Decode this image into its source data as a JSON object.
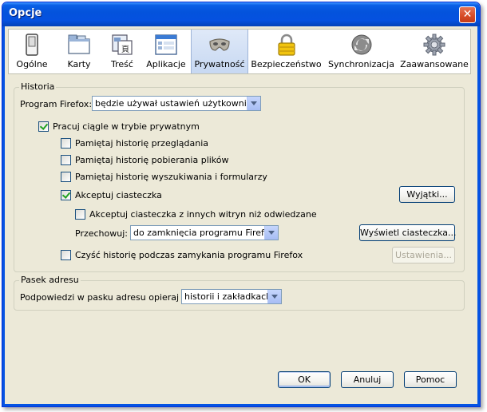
{
  "window": {
    "title": "Opcje",
    "close_glyph": "✕"
  },
  "toolbar": {
    "tabs": [
      {
        "label": "Ogólne",
        "icon": "switch-icon"
      },
      {
        "label": "Karty",
        "icon": "tabs-window-icon"
      },
      {
        "label": "Treść",
        "icon": "content-page-icon"
      },
      {
        "label": "Aplikacje",
        "icon": "applications-window-icon"
      },
      {
        "label": "Prywatność",
        "icon": "privacy-mask-icon"
      },
      {
        "label": "Bezpieczeństwo",
        "icon": "padlock-icon"
      },
      {
        "label": "Synchronizacja",
        "icon": "sync-icon"
      },
      {
        "label": "Zaawansowane",
        "icon": "gear-icon"
      }
    ],
    "selected": "Prywatność"
  },
  "history": {
    "group_title": "Historia",
    "program_label": "Program Firefox:",
    "program_value": "będzie używał ustawień użytkownika",
    "private_mode": {
      "label": "Pracuj ciągle w trybie prywatnym",
      "checked": true
    },
    "browse_history": {
      "label": "Pamiętaj historię przeglądania",
      "checked": false
    },
    "download_history": {
      "label": "Pamiętaj historię pobierania plików",
      "checked": false
    },
    "search_history": {
      "label": "Pamiętaj historię wyszukiwania i formularzy",
      "checked": false
    },
    "accept_cookies": {
      "label": "Akceptuj ciasteczka",
      "checked": true
    },
    "exceptions_button": "Wyjątki...",
    "third_party": {
      "label": "Akceptuj ciasteczka z innych witryn niż odwiedzane",
      "checked": false
    },
    "keep_label": "Przechowuj:",
    "keep_value": "do zamknięcia programu Firefox",
    "show_cookies_button": "Wyświetl ciasteczka...",
    "clear_on_close": {
      "label": "Czyść historię podczas zamykania programu Firefox",
      "checked": false
    },
    "settings_button": "Ustawienia..."
  },
  "address_bar": {
    "group_title": "Pasek adresu",
    "suggest_label": "Podpowiedzi w pasku adresu opieraj na:",
    "suggest_value": "historii i zakładkach"
  },
  "buttons": {
    "ok": "OK",
    "cancel": "Anuluj",
    "help": "Pomoc"
  },
  "colors": {
    "titlebar": "#0453dc",
    "dialog_bg": "#ece9d8",
    "selected_tab": "#c7d8f2"
  }
}
